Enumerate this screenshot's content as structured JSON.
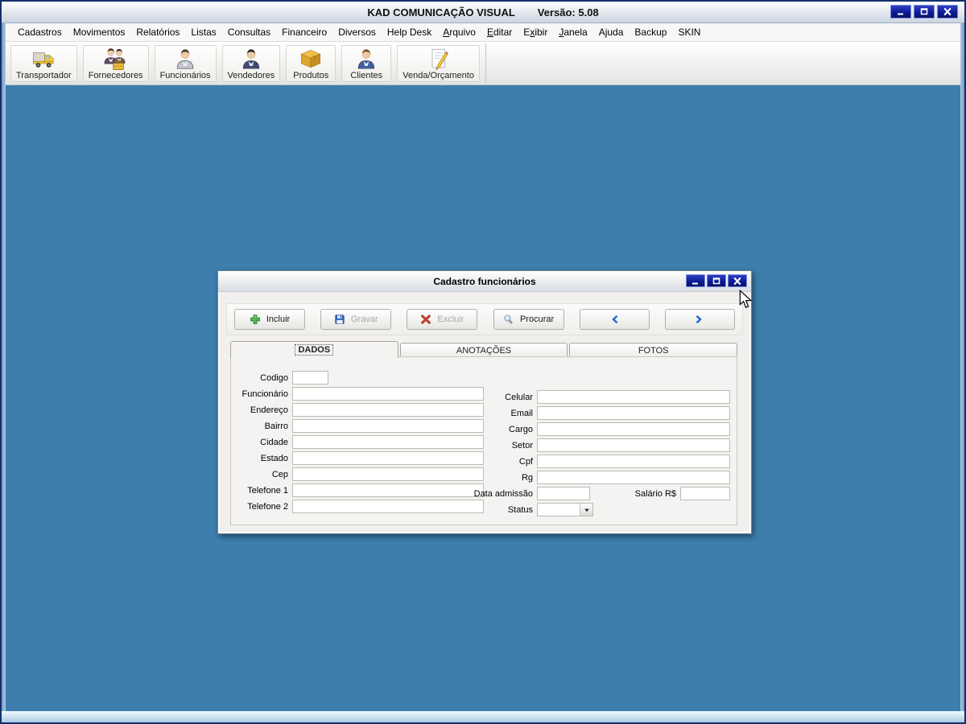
{
  "window": {
    "title": "KAD COMUNICAÇÃO VISUAL",
    "version": "Versão: 5.08",
    "controls": [
      {
        "icon": "minimize-icon"
      },
      {
        "icon": "maximize-icon"
      },
      {
        "icon": "close-icon"
      }
    ]
  },
  "menu": {
    "items": [
      {
        "label": "Cadastros"
      },
      {
        "label": "Movimentos"
      },
      {
        "label": "Relatórios"
      },
      {
        "label": "Listas"
      },
      {
        "label": "Consultas"
      },
      {
        "label": "Financeiro"
      },
      {
        "label": "Diversos"
      },
      {
        "label": "Help Desk"
      },
      {
        "label": "Arquivo",
        "accel_index": 0
      },
      {
        "label": "Editar",
        "accel_index": 0
      },
      {
        "label": "Exibir",
        "accel_index": 1
      },
      {
        "label": "Janela",
        "accel_index": 0
      },
      {
        "label": "Ajuda"
      },
      {
        "label": "Backup"
      },
      {
        "label": "SKIN"
      }
    ]
  },
  "toolbar": {
    "buttons": [
      {
        "label": "Transportador",
        "icon": "truck-icon"
      },
      {
        "label": "Fornecedores",
        "icon": "suppliers-icon"
      },
      {
        "label": "Funcionários",
        "icon": "employee-icon"
      },
      {
        "label": "Vendedores",
        "icon": "salesperson-icon"
      },
      {
        "label": "Produtos",
        "icon": "product-box-icon"
      },
      {
        "label": "Clientes",
        "icon": "client-icon"
      },
      {
        "label": "Venda/Orçamento",
        "icon": "sale-quote-icon"
      }
    ]
  },
  "dialog": {
    "title": "Cadastro funcionários",
    "controls": [
      {
        "icon": "minimize-icon"
      },
      {
        "icon": "maximize-icon"
      },
      {
        "icon": "close-icon"
      }
    ],
    "actions": [
      {
        "label": "Incluir",
        "icon": "plus-icon",
        "enabled": true,
        "nav": false
      },
      {
        "label": "Gravar",
        "icon": "save-icon",
        "enabled": false,
        "nav": false
      },
      {
        "label": "Excluir",
        "icon": "delete-x-icon",
        "enabled": false,
        "nav": false
      },
      {
        "label": "Procurar",
        "icon": "search-icon",
        "enabled": true,
        "nav": false
      },
      {
        "label": "",
        "icon": "arrow-left-icon",
        "enabled": true,
        "nav": true
      },
      {
        "label": "",
        "icon": "arrow-right-icon",
        "enabled": true,
        "nav": true
      }
    ],
    "tabs": [
      {
        "label": "DADOS",
        "active": true
      },
      {
        "label": "ANOTAÇÕES",
        "active": false
      },
      {
        "label": "FOTOS",
        "active": false
      }
    ],
    "form": {
      "left_fields": [
        {
          "label": "Codigo",
          "value": "",
          "short": true
        },
        {
          "label": "Funcionário",
          "value": ""
        },
        {
          "label": "Endereço",
          "value": ""
        },
        {
          "label": "Bairro",
          "value": ""
        },
        {
          "label": "Cidade",
          "value": ""
        },
        {
          "label": "Estado",
          "value": ""
        },
        {
          "label": "Cep",
          "value": ""
        },
        {
          "label": "Telefone 1",
          "value": ""
        },
        {
          "label": "Telefone 2",
          "value": ""
        }
      ],
      "right_fields": [
        {
          "label": "Celular",
          "value": ""
        },
        {
          "label": "Email",
          "value": ""
        },
        {
          "label": "Cargo",
          "value": ""
        },
        {
          "label": "Setor",
          "value": ""
        },
        {
          "label": "Cpf",
          "value": ""
        },
        {
          "label": "Rg",
          "value": ""
        }
      ],
      "data_admissao": {
        "label": "Data admissão",
        "value": ""
      },
      "salario": {
        "label": "Salário R$",
        "value": ""
      },
      "status": {
        "label": "Status",
        "value": ""
      }
    }
  },
  "colors": {
    "mdi_background": "#3D7EAD",
    "window_button": "#0d1c96",
    "window_button_light": "#3140c4",
    "accent_blue": "#1e6bd6",
    "action_green": "#52b552",
    "action_red": "#d6452f"
  }
}
